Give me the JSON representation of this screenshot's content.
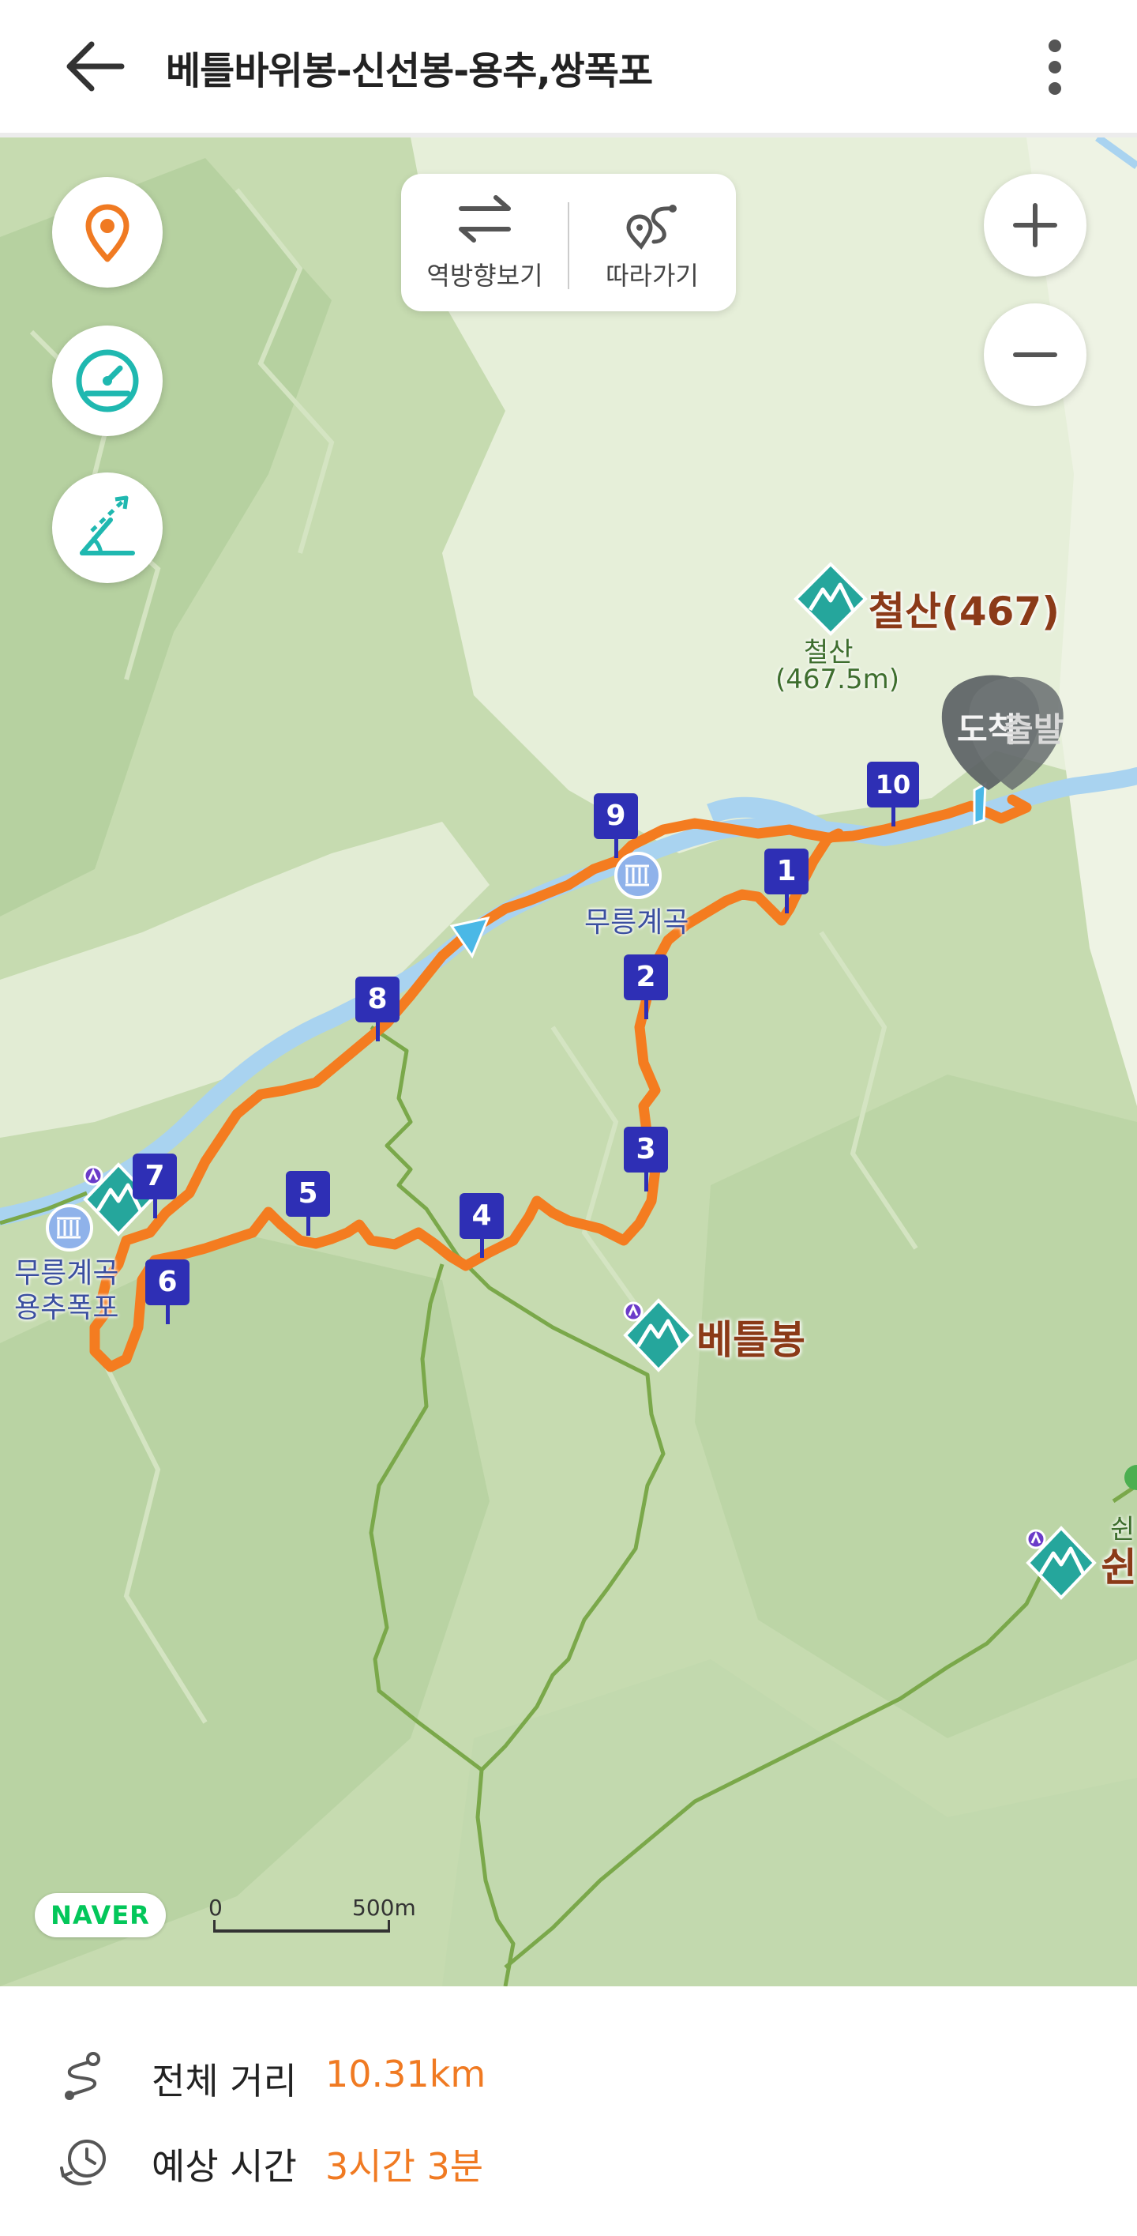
{
  "header": {
    "title": "베틀바위봉-신선봉-용추,쌍폭포"
  },
  "map_controls": {
    "reverse_label": "역방향보기",
    "follow_label": "따라가기"
  },
  "map_labels": {
    "cheolsan_big": "철산(467)",
    "cheolsan_small_name": "철산",
    "cheolsan_small_elev": "(467.5m)",
    "arrival": "도착",
    "departure": "출발",
    "mureung_valley": "무릉계곡",
    "mureung_yongchu_1": "무릉계곡",
    "mureung_yongchu_2": "용추폭포",
    "betteulbong": "베틀봉",
    "partial_peak_small": "쉰",
    "partial_peak_big": "쉰"
  },
  "waypoints": [
    "1",
    "2",
    "3",
    "4",
    "5",
    "6",
    "7",
    "8",
    "9",
    "10"
  ],
  "map_footer": {
    "brand": "NAVER",
    "scale_start": "0",
    "scale_end": "500m"
  },
  "summary": {
    "distance_label": "전체 거리",
    "distance_value": "10.31km",
    "time_label": "예상 시간",
    "time_value": "3시간 3분"
  },
  "colors": {
    "route": "#f47c20",
    "marker": "#2e2fb5",
    "accent": "#f07a22",
    "teal": "#1fb8b0",
    "water": "#a9d3f0"
  },
  "icons": [
    "back-arrow-icon",
    "more-vertical-icon",
    "location-pin-icon",
    "speedometer-icon",
    "slope-icon",
    "zoom-in-icon",
    "zoom-out-icon",
    "swap-direction-icon",
    "follow-route-icon",
    "route-distance-icon",
    "clock-icon"
  ]
}
